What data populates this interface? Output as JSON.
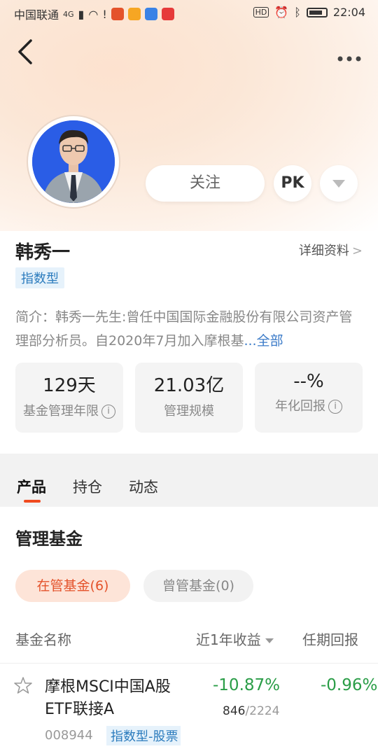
{
  "status_bar": {
    "carrier": "中国联通",
    "network": "4G",
    "time": "22:04",
    "hd": "HD"
  },
  "manager": {
    "name": "韩秀一",
    "detail_link": "详细资料",
    "type_tag": "指数型",
    "intro": "简介：韩秀一先生:曾任中国国际金融股份有限公司资产管理部分析员。自2020年7月加入摩根基",
    "intro_more": "...全部"
  },
  "actions": {
    "follow": "关注",
    "pk": "PK"
  },
  "stats": [
    {
      "value": "129天",
      "label": "基金管理年限"
    },
    {
      "value": "21.03亿",
      "label": "管理规模"
    },
    {
      "value": "--%",
      "label": "年化回报"
    }
  ],
  "tabs": [
    "产品",
    "持仓",
    "动态"
  ],
  "section_title": "管理基金",
  "chips": {
    "current": "在管基金(6)",
    "former": "曾管基金(0)"
  },
  "table_headers": {
    "name": "基金名称",
    "one_year": "近1年收益",
    "tenure": "任期回报"
  },
  "funds": [
    {
      "name": "摩根MSCI中国A股ETF联接A",
      "code": "008944",
      "tag": "指数型-股票",
      "one_year": "-10.87%",
      "rank": "846",
      "rank_total": "/2224",
      "tenure": "-0.96%"
    }
  ],
  "colors": {
    "accent": "#f04a1f",
    "negative": "#2a9d47",
    "tag_bg": "#e6f2fb",
    "tag_text": "#2b7bbd"
  }
}
